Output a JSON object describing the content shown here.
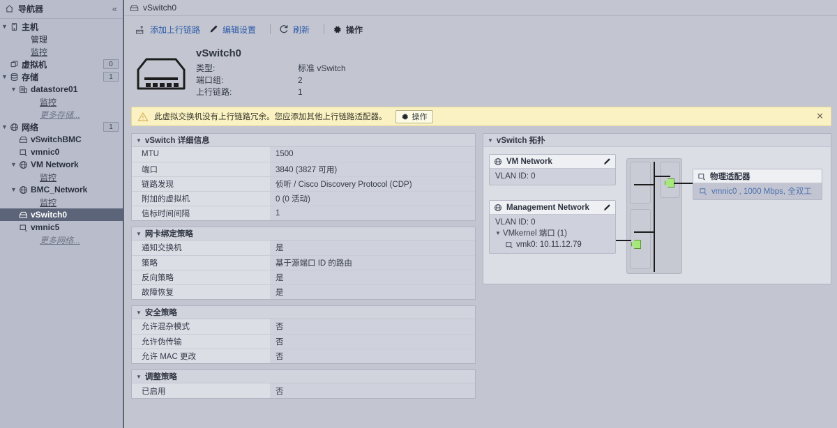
{
  "sidebar": {
    "header_title": "导航器",
    "collapse_icon": "chevron-double-left-icon",
    "home_icon": "home-icon",
    "items": [
      {
        "label": "主机",
        "icon": "host-icon",
        "indent": 0,
        "caret": "down",
        "bold": true,
        "badge": ""
      },
      {
        "label": "管理",
        "icon": "",
        "indent": 1,
        "caret": "",
        "bold": false,
        "badge": ""
      },
      {
        "label": "监控",
        "icon": "",
        "indent": 1,
        "caret": "",
        "bold": false,
        "badge": "",
        "link": true
      },
      {
        "label": "虚拟机",
        "icon": "vm-icon",
        "indent": 0,
        "caret": "",
        "bold": true,
        "badge": "0"
      },
      {
        "label": "存储",
        "icon": "storage-icon",
        "indent": 0,
        "caret": "down",
        "bold": true,
        "badge": "1"
      },
      {
        "label": "datastore01",
        "icon": "datastore-icon",
        "indent": 1,
        "caret": "down",
        "bold": true,
        "badge": ""
      },
      {
        "label": "监控",
        "icon": "",
        "indent": 2,
        "caret": "",
        "bold": false,
        "badge": "",
        "link": true
      },
      {
        "label": "更多存储...",
        "icon": "",
        "indent": 2,
        "caret": "",
        "bold": false,
        "badge": "",
        "more": true
      },
      {
        "label": "网络",
        "icon": "network-icon",
        "indent": 0,
        "caret": "down",
        "bold": true,
        "badge": "1"
      },
      {
        "label": "vSwitchBMC",
        "icon": "vswitch-icon",
        "indent": 1,
        "caret": "",
        "bold": true,
        "badge": ""
      },
      {
        "label": "vmnic0",
        "icon": "nic-icon",
        "indent": 1,
        "caret": "",
        "bold": true,
        "badge": ""
      },
      {
        "label": "VM Network",
        "icon": "network-icon",
        "indent": 1,
        "caret": "down",
        "bold": true,
        "badge": ""
      },
      {
        "label": "监控",
        "icon": "",
        "indent": 2,
        "caret": "",
        "bold": false,
        "badge": "",
        "link": true
      },
      {
        "label": "BMC_Network",
        "icon": "network-icon",
        "indent": 1,
        "caret": "down",
        "bold": true,
        "badge": ""
      },
      {
        "label": "监控",
        "icon": "",
        "indent": 2,
        "caret": "",
        "bold": false,
        "badge": "",
        "link": true
      },
      {
        "label": "vSwitch0",
        "icon": "vswitch-icon",
        "indent": 1,
        "caret": "",
        "bold": true,
        "badge": "",
        "selected": true
      },
      {
        "label": "vmnic5",
        "icon": "nic-icon",
        "indent": 1,
        "caret": "",
        "bold": true,
        "badge": ""
      },
      {
        "label": "更多网络...",
        "icon": "",
        "indent": 2,
        "caret": "",
        "bold": false,
        "badge": "",
        "more": true
      }
    ]
  },
  "breadcrumb": {
    "icon": "vswitch-icon",
    "label": "vSwitch0"
  },
  "toolbar": {
    "add_uplink": "添加上行链路",
    "add_uplink_icon": "add-uplink-icon",
    "edit_settings": "编辑设置",
    "edit_settings_icon": "pencil-icon",
    "refresh": "刷新",
    "refresh_icon": "refresh-icon",
    "actions": "操作",
    "actions_icon": "gear-icon"
  },
  "switch_header": {
    "icon": "vswitch-large-icon",
    "name": "vSwitch0",
    "rows": [
      {
        "key": "类型:",
        "value": "标准 vSwitch"
      },
      {
        "key": "端口组:",
        "value": "2"
      },
      {
        "key": "上行链路:",
        "value": "1"
      }
    ]
  },
  "warning": {
    "icon": "warning-triangle-icon",
    "text": "此虚拟交换机没有上行链路冗余。您应添加其他上行链路适配器。",
    "button_label": "操作",
    "button_icon": "gear-icon",
    "close_icon": "close-icon"
  },
  "details_card": {
    "title": "vSwitch 详细信息",
    "rows": [
      {
        "key": "MTU",
        "value": "1500"
      },
      {
        "key": "端口",
        "value": "3840 (3827 可用)"
      },
      {
        "key": "链路发现",
        "value": "侦听 / Cisco Discovery Protocol (CDP)"
      },
      {
        "key": "附加的虚拟机",
        "value": "0 (0 活动)"
      },
      {
        "key": "信标时间间隔",
        "value": "1"
      }
    ]
  },
  "nic_teaming_card": {
    "title": "网卡绑定策略",
    "rows": [
      {
        "key": "通知交换机",
        "value": "是"
      },
      {
        "key": "策略",
        "value": "基于源端口 ID 的路由"
      },
      {
        "key": "反向策略",
        "value": "是"
      },
      {
        "key": "故障恢复",
        "value": "是"
      }
    ]
  },
  "security_card": {
    "title": "安全策略",
    "rows": [
      {
        "key": "允许混杂模式",
        "value": "否"
      },
      {
        "key": "允许伪传输",
        "value": "否"
      },
      {
        "key": "允许 MAC 更改",
        "value": "否"
      }
    ]
  },
  "shaping_card": {
    "title": "调整策略",
    "rows": [
      {
        "key": "已启用",
        "value": "否"
      }
    ]
  },
  "topology_card": {
    "title": "vSwitch 拓扑",
    "portgroups": [
      {
        "icon": "network-icon",
        "name": "VM Network",
        "edit_icon": "pencil-icon",
        "vlan": "VLAN ID: 0"
      },
      {
        "icon": "network-icon",
        "name": "Management Network",
        "edit_icon": "pencil-icon",
        "vlan": "VLAN ID: 0",
        "vmkernel_label": "VMkernel 端口 (1)",
        "vmk_icon": "nic-icon",
        "vmk_entry": "vmk0: 10.11.12.79"
      }
    ],
    "adapter": {
      "icon": "nic-icon",
      "title": "物理适配器",
      "row_icon": "nic-icon",
      "row_label": "vmnic0 , 1000 Mbps, 全双工"
    }
  },
  "colors": {
    "page_bg": "#c3c6d1",
    "sidebar_bg": "#b9bdcb",
    "selection": "#5b6478",
    "link": "#2c5ba8",
    "warning_bg": "#fbf2c4",
    "warning_border": "#e3d79b",
    "card_bg": "#dcdee5",
    "nub_green": "#a6e87a"
  }
}
